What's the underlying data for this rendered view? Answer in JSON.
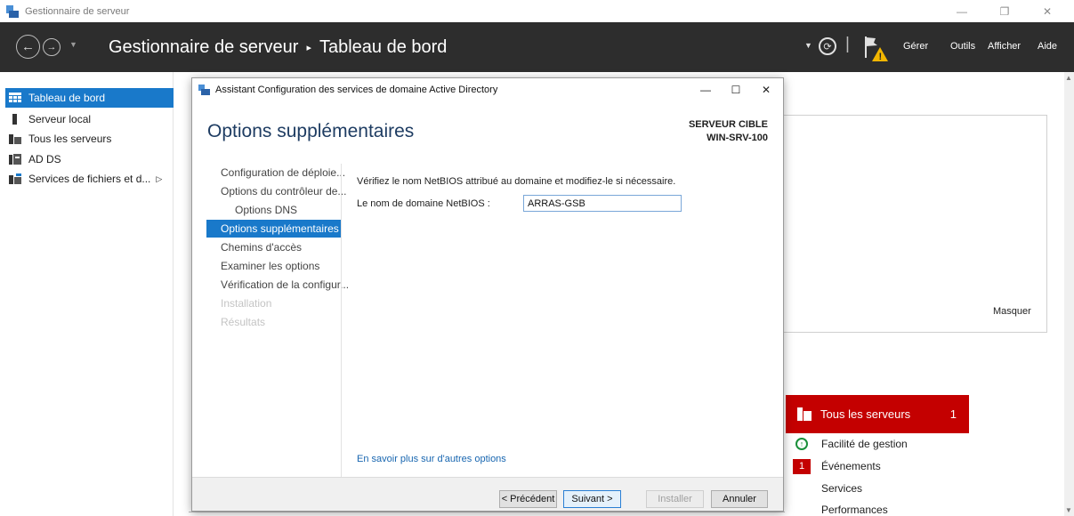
{
  "window": {
    "title": "Gestionnaire de serveur",
    "controls": {
      "minimize": "—",
      "restore": "❐",
      "close": "✕"
    }
  },
  "header": {
    "breadcrumb_root": "Gestionnaire de serveur",
    "breadcrumb_sep": "▸",
    "breadcrumb_page": "Tableau de bord",
    "menus": [
      "Gérer",
      "Outils",
      "Afficher",
      "Aide"
    ]
  },
  "sidebar": {
    "items": [
      {
        "label": "Tableau de bord",
        "icon": "dashboard-icon"
      },
      {
        "label": "Serveur local",
        "icon": "server-icon"
      },
      {
        "label": "Tous les serveurs",
        "icon": "servers-icon"
      },
      {
        "label": "AD DS",
        "icon": "ad-ds-icon"
      },
      {
        "label": "Services de fichiers et d...",
        "icon": "file-services-icon",
        "arrow": "▷"
      }
    ]
  },
  "background": {
    "hide_label": "Masquer",
    "tile": {
      "title": "Tous les serveurs",
      "count": "1",
      "rows": [
        "Facilité de gestion",
        "Événements",
        "Services",
        "Performances"
      ],
      "events_badge": "1"
    }
  },
  "dialog": {
    "title": "Assistant Configuration des services de domaine Active Directory",
    "heading": "Options supplémentaires",
    "target_label": "SERVEUR CIBLE",
    "target_value": "WIN-SRV-100",
    "steps": [
      {
        "label": "Configuration de déploie...",
        "state": "normal"
      },
      {
        "label": "Options du contrôleur de...",
        "state": "normal"
      },
      {
        "label": "Options DNS",
        "state": "normal"
      },
      {
        "label": "Options supplémentaires",
        "state": "active"
      },
      {
        "label": "Chemins d'accès",
        "state": "normal"
      },
      {
        "label": "Examiner les options",
        "state": "normal"
      },
      {
        "label": "Vérification de la configur...",
        "state": "normal"
      },
      {
        "label": "Installation",
        "state": "disabled"
      },
      {
        "label": "Résultats",
        "state": "disabled"
      }
    ],
    "instruction": "Vérifiez le nom NetBIOS attribué au domaine et modifiez-le si nécessaire.",
    "netbios_label": "Le nom de domaine NetBIOS :",
    "netbios_value": "ARRAS-GSB",
    "learn_more": "En savoir plus sur d'autres options",
    "buttons": {
      "previous": "< Précédent",
      "next": "Suivant >",
      "install": "Installer",
      "cancel": "Annuler"
    }
  }
}
